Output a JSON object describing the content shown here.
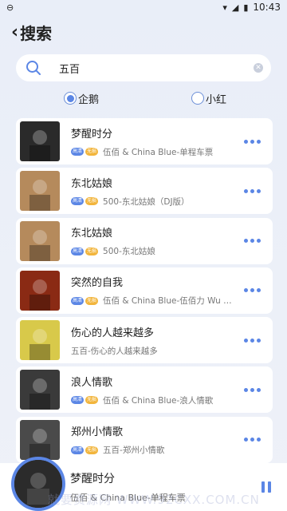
{
  "status": {
    "time": "10:43",
    "icons": [
      "minus-circle-icon",
      "wifi-icon",
      "signal-icon",
      "battery-icon"
    ]
  },
  "header": {
    "title": "搜索"
  },
  "search": {
    "value": "五百",
    "placeholder": ""
  },
  "sources": [
    {
      "label": "企鹅",
      "selected": true
    },
    {
      "label": "小红",
      "selected": false
    }
  ],
  "tags": {
    "hq": "高清",
    "free": "无损"
  },
  "songs": [
    {
      "title": "梦醒时分",
      "artist": "伍佰 & China Blue-单程车票",
      "tags": true,
      "cover": "#2a2a2a"
    },
    {
      "title": "东北姑娘",
      "artist": "500-东北姑娘（DJ版）",
      "tags": true,
      "cover": "#b58a5c"
    },
    {
      "title": "东北姑娘",
      "artist": "500-东北姑娘",
      "tags": true,
      "cover": "#b58a5c"
    },
    {
      "title": "突然的自我",
      "artist": "伍佰 & China Blue-伍佰力 Wu Bai...",
      "tags": true,
      "cover": "#8a2a14"
    },
    {
      "title": "伤心的人越来越多",
      "artist": "五百-伤心的人越来越多",
      "tags": false,
      "cover": "#d8c94a"
    },
    {
      "title": "浪人情歌",
      "artist": "伍佰 & China Blue-浪人情歌",
      "tags": true,
      "cover": "#3a3a3a"
    },
    {
      "title": "郑州小情歌",
      "artist": "五百-郑州小情歌",
      "tags": true,
      "cover": "#4a4a4a"
    }
  ],
  "player": {
    "title": "梦醒时分",
    "artist": "伍佰 & China Blue-单程车票",
    "watermark": "就要资源网 WWW.92CXX.COM.CN"
  },
  "colors": {
    "accent": "#5b86e5",
    "free_tag": "#f2b53c",
    "background": "#e9eef8"
  }
}
